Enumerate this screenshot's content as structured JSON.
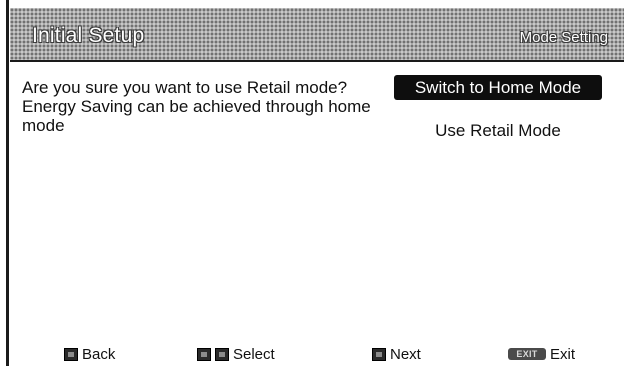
{
  "header": {
    "title": "Initial Setup",
    "section": "Mode Setting"
  },
  "body": {
    "prompt": "Are you sure you want to use Retail mode? Energy Saving can be achieved through home mode",
    "options": [
      {
        "label": "Switch to Home Mode",
        "selected": true
      },
      {
        "label": "Use Retail Mode",
        "selected": false
      }
    ]
  },
  "footer": {
    "back": {
      "label": "Back",
      "icon": "back-key-icon"
    },
    "select": {
      "label": "Select",
      "icon": "up-down-keys-icon"
    },
    "next": {
      "label": "Next",
      "icon": "next-key-icon"
    },
    "exit": {
      "label": "Exit",
      "icon": "exit-key-icon",
      "key_text": "EXIT"
    }
  },
  "colors": {
    "header_band": "#a8a8a8",
    "selected_option_bg": "#0e0e0e",
    "selected_option_text": "#ffffff",
    "text": "#111111"
  }
}
